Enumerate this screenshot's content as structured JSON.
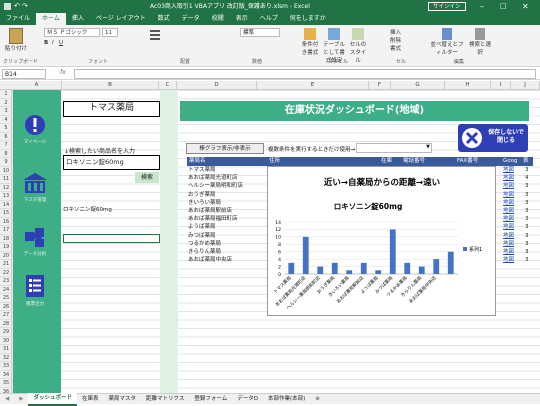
{
  "titlebar": {
    "title": "Ac03商入取引1 VBAアプリ 改訂版_保護あり.xlsm - Excel",
    "signin": "サインイン"
  },
  "ribbon": {
    "tabs": [
      "ファイル",
      "ホーム",
      "挿入",
      "ページ レイアウト",
      "数式",
      "データ",
      "校閲",
      "表示",
      "ヘルプ",
      "何をしますか"
    ],
    "active_tab": "ホーム",
    "paste": "貼り付け",
    "clipboard": "クリップボード",
    "font_name": "ＭＳ Ｐゴシック",
    "font_size": "11",
    "font_group": "フォント",
    "align_group": "配置",
    "number_format": "標準",
    "number_group": "数値",
    "styles": [
      "条件付き書式",
      "テーブルとして書式設定",
      "セルのスタイル"
    ],
    "style_group": "スタイル",
    "cells": [
      "挿入",
      "削除",
      "書式"
    ],
    "cell_group": "セル",
    "edit": [
      "並べ替えとフィルター",
      "検索と選択"
    ],
    "edit_group": "編集"
  },
  "formula_bar": {
    "name_box": "B14",
    "fx": "fx",
    "content": ""
  },
  "columns": [
    "A",
    "B",
    "C",
    "D",
    "E",
    "F",
    "G",
    "H",
    "I",
    "J",
    "K"
  ],
  "rows": [
    "1",
    "2",
    "3",
    "4",
    "5",
    "6",
    "7",
    "8",
    "9",
    "10",
    "11",
    "12",
    "13",
    "14",
    "15",
    "16",
    "17",
    "18",
    "19",
    "20",
    "21",
    "22",
    "23",
    "24",
    "25",
    "26",
    "27",
    "28",
    "29",
    "30",
    "31",
    "32",
    "33",
    "34",
    "35",
    "36"
  ],
  "sidebar": {
    "items": [
      "マイページ",
      "マスタ管理",
      "データ分析",
      "帳票出力"
    ]
  },
  "sheet": {
    "store_name": "トマス薬局",
    "search_prompt": "↓検索したい商品名を入力",
    "search_value": "ロキソニン錠60mg",
    "search_button": "検索",
    "result_value": "ロキソニン錠60mg",
    "toggle_button": "棒グラフ表示/非表示",
    "filter_label": "複数条件を実行するときだけ使用→",
    "banner": "在庫状況ダッシュボード(地域)",
    "close_button": "保存しないで\n閉じる"
  },
  "table": {
    "headers": [
      "薬局名",
      "住所",
      "在庫",
      "電話番号",
      "FAX番号",
      "Goog",
      "表"
    ],
    "rows": [
      {
        "name": "トマス薬局",
        "link": "地図"
      },
      {
        "name": "あおば薬局光道町店",
        "link": "地図"
      },
      {
        "name": "ヘルシー薬局明和町店",
        "link": "地図"
      },
      {
        "name": "おうぎ薬局",
        "link": "地図"
      },
      {
        "name": "きいろい薬局",
        "link": "地図"
      },
      {
        "name": "あおば薬局駅前店",
        "link": "地図"
      },
      {
        "name": "あおば薬局福田町店",
        "link": "地図"
      },
      {
        "name": "ようば薬局",
        "link": "地図"
      },
      {
        "name": "みつば薬局",
        "link": "地図"
      },
      {
        "name": "つるかめ薬局",
        "link": "地図"
      },
      {
        "name": "きらりん薬局",
        "link": "地図"
      },
      {
        "name": "あおば薬局中央店",
        "link": "地図"
      }
    ],
    "tail_values": [
      "3",
      "4",
      "3",
      "3",
      "3",
      "3",
      "3",
      "3",
      "3",
      "3",
      "3",
      "3"
    ]
  },
  "chart_data": {
    "type": "bar",
    "title": "近い→自薬局からの距離→遠い",
    "subtitle": "ロキソニン錠60mg",
    "categories": [
      "トマス薬局",
      "あおば薬局光道町店",
      "ヘルシー薬局明和町店",
      "おうぎ薬局",
      "きいろい薬局",
      "あおば薬局駅前店",
      "ようば薬局",
      "みつば薬局",
      "つるかめ薬局",
      "きらりん薬局",
      "あおば薬局中央店"
    ],
    "series": [
      {
        "name": "系列1",
        "values": [
          3,
          10,
          2,
          3,
          1,
          3,
          1,
          12,
          3,
          2,
          4,
          6
        ]
      }
    ],
    "ylim": [
      0,
      14
    ],
    "yticks": [
      0,
      2,
      4,
      6,
      8,
      10,
      12,
      14
    ],
    "legend": "right",
    "bar_color": "#4472c4"
  },
  "sheet_tabs": [
    "ダッシュボード",
    "在庫表",
    "薬局マスタ",
    "距離マトリクス",
    "登録フォーム",
    "データD",
    "本部作業(本部)"
  ],
  "active_sheet": "ダッシュボード"
}
